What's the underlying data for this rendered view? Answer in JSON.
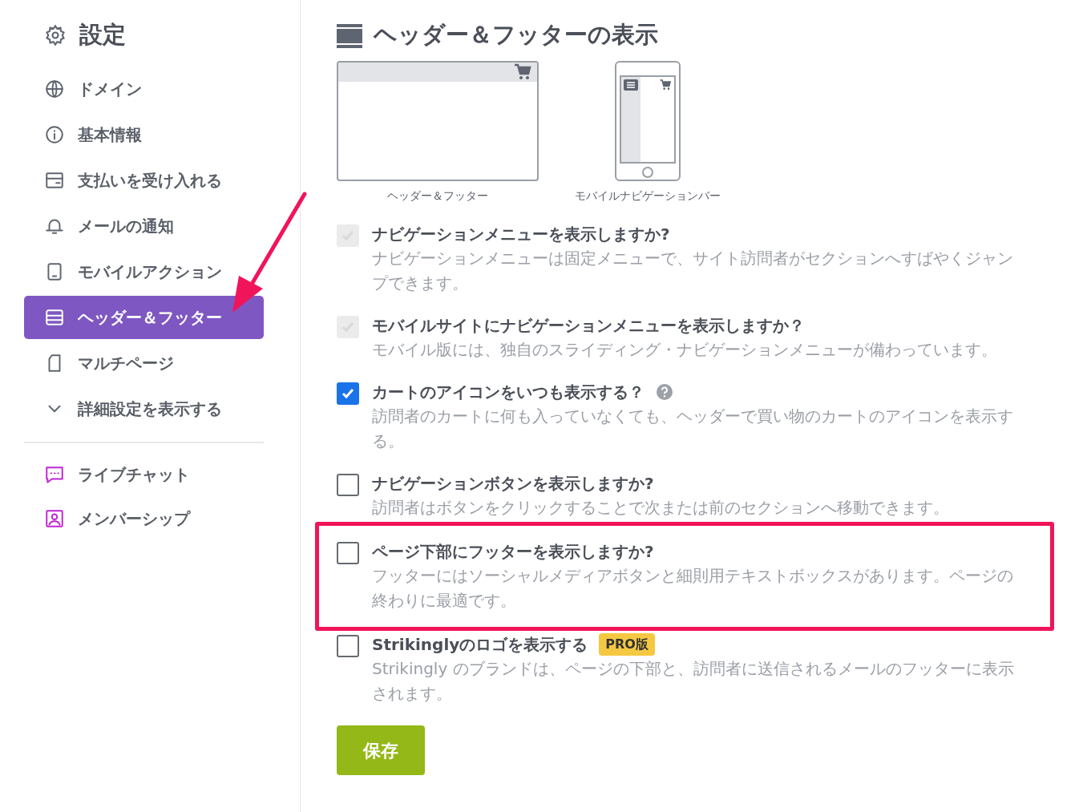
{
  "sidebar": {
    "title": "設定",
    "items": [
      {
        "label": "ドメイン",
        "selected": false,
        "kind": "globe"
      },
      {
        "label": "基本情報",
        "selected": false,
        "kind": "info"
      },
      {
        "label": "支払いを受け入れる",
        "selected": false,
        "kind": "wallet"
      },
      {
        "label": "メールの通知",
        "selected": false,
        "kind": "bell"
      },
      {
        "label": "モバイルアクション",
        "selected": false,
        "kind": "phone"
      },
      {
        "label": "ヘッダー＆フッター",
        "selected": true,
        "kind": "header"
      },
      {
        "label": "マルチページ",
        "selected": false,
        "kind": "page"
      },
      {
        "label": "詳細設定を表示する",
        "selected": false,
        "kind": "chevron"
      }
    ],
    "extras": [
      {
        "label": "ライブチャット",
        "kind": "chat"
      },
      {
        "label": "メンバーシップ",
        "kind": "member"
      }
    ]
  },
  "main": {
    "title": "ヘッダー＆フッターの表示",
    "previews": [
      {
        "caption": "ヘッダー＆フッター",
        "kind": "desktop"
      },
      {
        "caption": "モバイルナビゲーションバー",
        "kind": "mobile"
      }
    ],
    "options": [
      {
        "title": "ナビゲーションメニューを表示しますか?",
        "description": "ナビゲーションメニューは固定メニューで、サイト訪問者がセクションへすばやくジャンプできます。",
        "checked": true,
        "disabled": true,
        "highlighted": false
      },
      {
        "title": "モバイルサイトにナビゲーションメニューを表示しますか？",
        "description": "モバイル版には、独自のスライディング・ナビゲーションメニューが備わっています。",
        "checked": true,
        "disabled": true,
        "highlighted": false
      },
      {
        "title": "カートのアイコンをいつも表示する？",
        "description": "訪問者のカートに何も入っていなくても、ヘッダーで買い物のカートのアイコンを表示する。",
        "checked": true,
        "disabled": false,
        "highlighted": false,
        "help": true
      },
      {
        "title": "ナビゲーションボタンを表示しますか?",
        "description": "訪問者はボタンをクリックすることで次または前のセクションへ移動できます。",
        "checked": false,
        "disabled": false,
        "highlighted": false
      },
      {
        "title": "ページ下部にフッターを表示しますか?",
        "description": "フッターにはソーシャルメディアボタンと細則用テキストボックスがあります。ページの終わりに最適です。",
        "checked": false,
        "disabled": false,
        "highlighted": true
      },
      {
        "title": "Strikinglyのロゴを表示する",
        "description": "Strikingly のブランドは、ページの下部と、訪問者に送信されるメールのフッターに表示されます。",
        "checked": false,
        "disabled": false,
        "highlighted": false,
        "badge": "PRO版"
      }
    ],
    "save_button": "保存"
  }
}
